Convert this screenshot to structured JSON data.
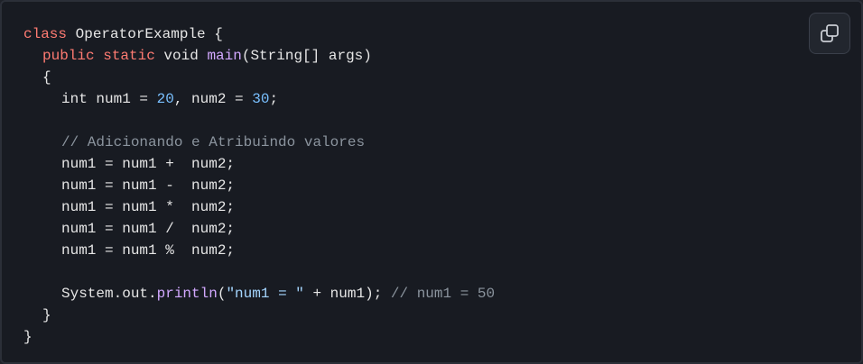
{
  "code": {
    "l1": {
      "kw": "class",
      "rest": " OperatorExample {"
    },
    "l2": {
      "kw1": "public",
      "kw2": "static",
      "type": " void ",
      "fn": "main",
      "rest": "(String[] args)"
    },
    "l3": {
      "text": "{"
    },
    "l4": {
      "a": "int num1 = ",
      "n1": "20",
      "b": ", num2 = ",
      "n2": "30",
      "c": ";"
    },
    "l6": {
      "comment": "// Adicionando e Atribuindo valores"
    },
    "l7": {
      "text": "num1 = num1 +  num2;"
    },
    "l8": {
      "text": "num1 = num1 -  num2;"
    },
    "l9": {
      "text": "num1 = num1 *  num2;"
    },
    "l10": {
      "text": "num1 = num1 /  num2;"
    },
    "l11": {
      "text": "num1 = num1 %  num2;"
    },
    "l13": {
      "a": "System.out.",
      "fn": "println",
      "b": "(",
      "str": "\"num1 = \"",
      "c": " + num1); ",
      "comment": "// num1 = 50"
    },
    "l14": {
      "text": "}"
    },
    "l15": {
      "text": "}"
    }
  },
  "copy_button": {
    "icon": "copy-icon"
  },
  "colors": {
    "background": "#181b22",
    "keyword": "#ff7b72",
    "function": "#d2a8ff",
    "number": "#79c0ff",
    "string": "#a5d6ff",
    "comment": "#8b949e"
  }
}
